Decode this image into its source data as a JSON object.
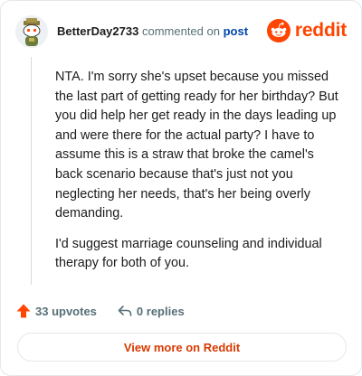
{
  "header": {
    "username": "BetterDay2733",
    "commented_text": "commented on",
    "post_link": "post",
    "brand_wordmark": "reddit"
  },
  "comment": {
    "paragraphs": [
      "NTA. I'm sorry she's upset because you missed the last part of getting ready for her birthday? But you did help her get ready in the days leading up and were there for the actual party? I have to assume this is a straw that broke the camel's back scenario because that's just not you neglecting her needs, that's her being overly demanding.",
      "I'd suggest marriage counseling and individual therapy for both of you."
    ]
  },
  "actions": {
    "upvotes": "33 upvotes",
    "replies": "0 replies"
  },
  "footer": {
    "view_more": "View more on Reddit"
  },
  "colors": {
    "brand": "#ff4500",
    "upvote": "#ff4500",
    "link": "#0045ac",
    "muted": "#576f76",
    "view_more_text": "#d93900"
  },
  "icons": {
    "avatar": "snoo-avatar",
    "brand": "reddit-logo-icon",
    "upvote": "upvote-arrow-icon",
    "reply": "reply-arrow-icon"
  }
}
